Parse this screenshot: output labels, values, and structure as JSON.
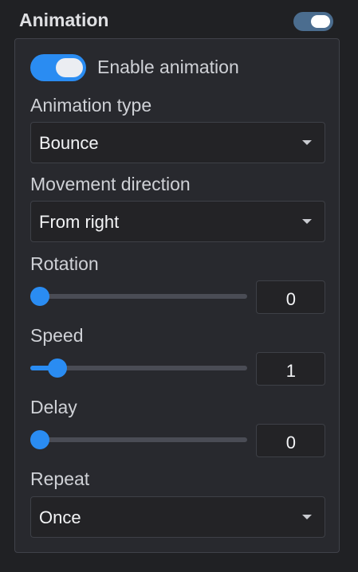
{
  "section": {
    "title": "Animation",
    "header_toggle_on": true
  },
  "enable": {
    "label": "Enable animation",
    "on": true
  },
  "animation_type": {
    "label": "Animation type",
    "value": "Bounce"
  },
  "movement_direction": {
    "label": "Movement direction",
    "value": "From right"
  },
  "rotation": {
    "label": "Rotation",
    "value": "0",
    "fraction": 0.0
  },
  "speed": {
    "label": "Speed",
    "value": "1",
    "fraction": 0.09
  },
  "delay": {
    "label": "Delay",
    "value": "0",
    "fraction": 0.0
  },
  "repeat": {
    "label": "Repeat",
    "value": "Once"
  },
  "colors": {
    "accent": "#2a8cf2",
    "header_toggle": "#4b6d8f",
    "panel_bg": "#28292e",
    "page_bg": "#202124"
  },
  "icons": {
    "dropdown": "caret-down-icon"
  }
}
